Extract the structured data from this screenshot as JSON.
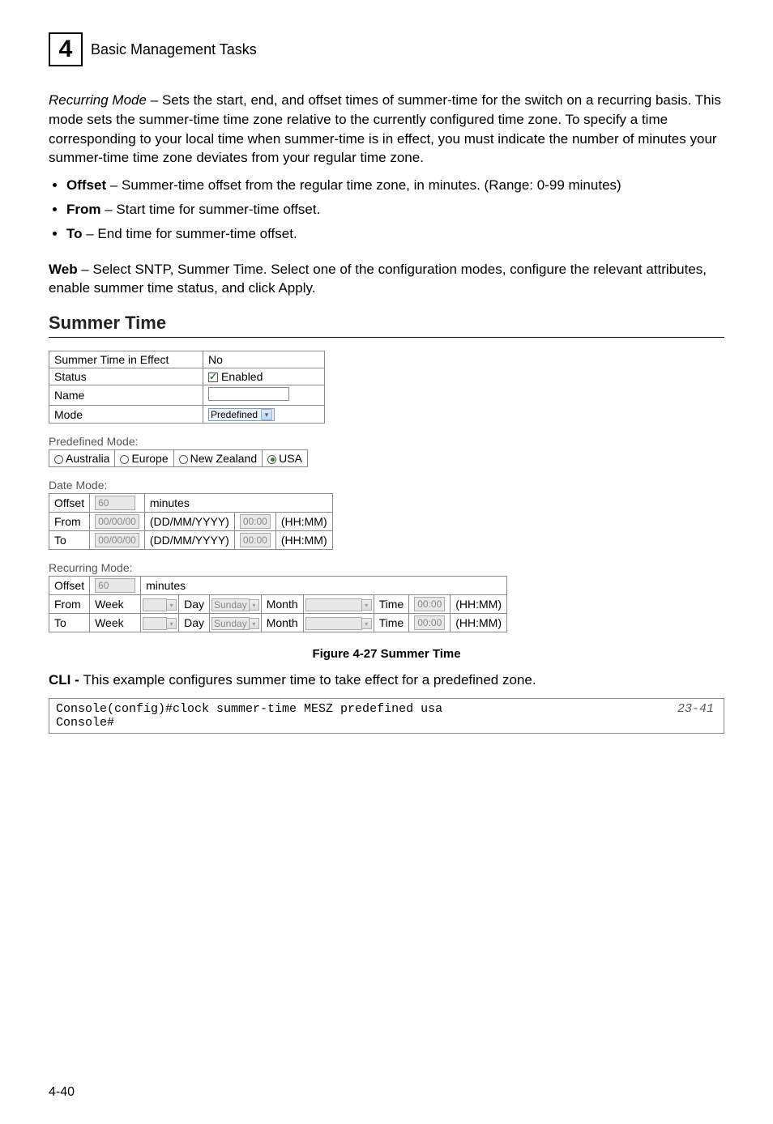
{
  "header": {
    "chapter_number": "4",
    "chapter_title": "Basic Management Tasks"
  },
  "intro": {
    "recurring_mode_label": "Recurring Mode",
    "recurring_mode_text": " – Sets the start, end, and offset times of summer-time for the switch on a recurring basis. This mode sets the summer-time time zone relative to the currently configured time zone. To specify a time corresponding to your local time when summer-time is in effect, you must indicate the number of minutes your summer-time time zone deviates from your regular time zone.",
    "bullets": [
      {
        "term": "Offset",
        "desc": " – Summer-time offset from the regular time zone, in minutes. (Range: 0-99 minutes)"
      },
      {
        "term": "From",
        "desc": " – Start time for summer-time offset."
      },
      {
        "term": "To",
        "desc": " – End time for summer-time offset."
      }
    ],
    "web_label": "Web",
    "web_text": " – Select SNTP, Summer Time. Select one of the configuration modes, configure the relevant attributes, enable summer time status, and click Apply."
  },
  "summer_section_title": "Summer Time",
  "top_table": {
    "rows": [
      {
        "label": "Summer Time in Effect",
        "value_type": "text",
        "value": "No"
      },
      {
        "label": "Status",
        "value_type": "checkbox",
        "value": "Enabled"
      },
      {
        "label": "Name",
        "value_type": "input",
        "value": ""
      },
      {
        "label": "Mode",
        "value_type": "select",
        "value": "Predefined"
      }
    ]
  },
  "predefined": {
    "label": "Predefined Mode:",
    "options": [
      "Australia",
      "Europe",
      "New Zealand",
      "USA"
    ],
    "selected": "USA"
  },
  "date_mode": {
    "label": "Date Mode:",
    "offset_label": "Offset",
    "offset_value": "60",
    "offset_unit": "minutes",
    "rows": [
      {
        "label": "From",
        "date": "00/00/00",
        "fmt": "(DD/MM/YYYY)",
        "time": "00:00",
        "tfmt": "(HH:MM)"
      },
      {
        "label": "To",
        "date": "00/00/00",
        "fmt": "(DD/MM/YYYY)",
        "time": "00:00",
        "tfmt": "(HH:MM)"
      }
    ]
  },
  "recurring_mode": {
    "label": "Recurring Mode:",
    "offset_label": "Offset",
    "offset_value": "60",
    "offset_unit": "minutes",
    "rows": [
      {
        "label": "From",
        "week_label": "Week",
        "week_val": "",
        "day_label": "Day",
        "day_val": "Sunday",
        "month_label": "Month",
        "month_val": "",
        "time_label": "Time",
        "time_val": "00:00",
        "tfmt": "(HH:MM)"
      },
      {
        "label": "To",
        "week_label": "Week",
        "week_val": "",
        "day_label": "Day",
        "day_val": "Sunday",
        "month_label": "Month",
        "month_val": "",
        "time_label": "Time",
        "time_val": "00:00",
        "tfmt": "(HH:MM)"
      }
    ]
  },
  "figure_caption": "Figure 4-27   Summer Time",
  "cli": {
    "label": "CLI - ",
    "text": "This example configures summer time to take effect for a predefined zone.",
    "code_line1": "Console(config)#clock summer-time MESZ predefined usa",
    "code_line2": "Console#",
    "ref": "23-41"
  },
  "page_number": "4-40"
}
